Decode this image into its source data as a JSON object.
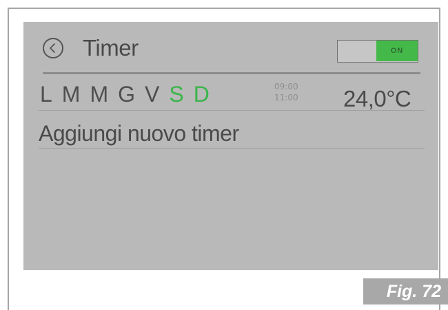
{
  "header": {
    "back_icon": "chevron-left-circle-icon",
    "title": "Timer",
    "toggle_label": "ON",
    "toggle_state": "on",
    "toggle_color": "#44b94a"
  },
  "timer_entry": {
    "days": [
      {
        "label": "L",
        "active": false
      },
      {
        "label": "M",
        "active": false
      },
      {
        "label": "M",
        "active": false
      },
      {
        "label": "G",
        "active": false
      },
      {
        "label": "V",
        "active": false
      },
      {
        "label": "S",
        "active": true
      },
      {
        "label": "D",
        "active": true
      }
    ],
    "start_time": "09:00",
    "end_time": "11:00",
    "temperature": "24,0°C",
    "active_day_color": "#3ab54a"
  },
  "add_timer_label": "Aggiungi nuovo timer",
  "figure_label": "Fig. 72"
}
